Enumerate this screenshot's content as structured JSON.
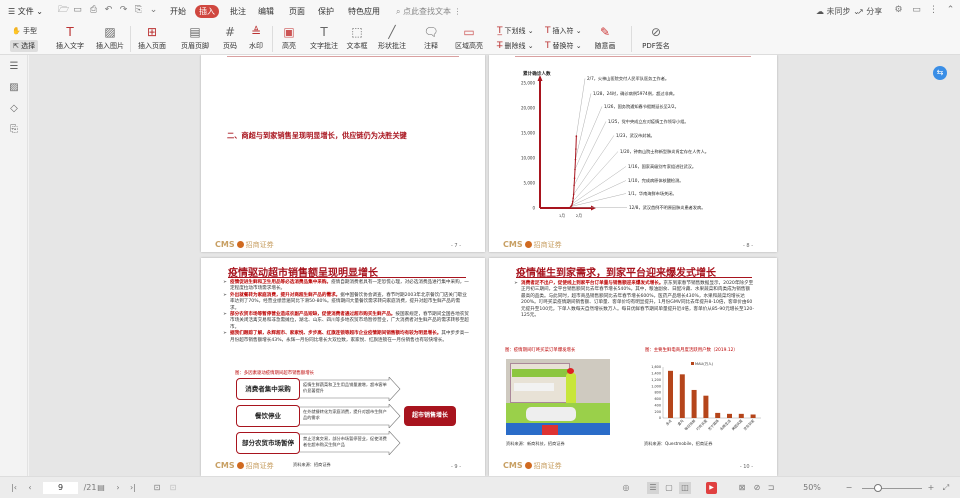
{
  "menu": {
    "file": "文件",
    "tabs": [
      "开始",
      "插入",
      "批注",
      "编辑",
      "页面",
      "保护",
      "特色应用"
    ],
    "active_tab": "插入",
    "search_placeholder": "点此查找文本",
    "sync": "未同步",
    "share": "分享"
  },
  "toolbar": {
    "hand": "手型",
    "select": "选择",
    "items": [
      "插入文字",
      "插入图片",
      "插入页面",
      "页眉页脚",
      "页码",
      "水印",
      "高亮",
      "文字批注",
      "文本框",
      "形状批注",
      "注释",
      "区域高亮"
    ],
    "underline": "下划线",
    "strikethrough": "删除线",
    "insert_mark": "插入符",
    "replace_mark": "替换符",
    "freehand": "随意画",
    "pdf_sign": "PDF签名"
  },
  "accent": "#d0473f",
  "brand": {
    "logo_text": "CMS",
    "logo_cn": "招商证券",
    "color": "#c8a064"
  },
  "pages": {
    "p7": {
      "heading": "二、商超与到家销售呈现明显增长，供应链仍为决胜关键",
      "page_no": "- 7 -"
    },
    "p8": {
      "page_no": "- 8 -"
    },
    "p9": {
      "title": "疫情驱动超市销售额呈现明显增长",
      "bullets": [
        {
          "bold": "疫情促进生鲜和卫生用品等必选消费品集中采购。",
          "text": "疫情自期消费者具有一定恐慌心理，对必选消费品进行集中采购，一定程度拉动市场需求增长。"
        },
        {
          "bold": "外出就餐转为家庭消费，提升对商超生鲜产品的需求。",
          "text": "据中国餐饮协会调查，春节时期2003年北京餐饮门店关门歇业率达到了70%，经营业绩普遍同比下滑50-80%。疫情期间大量餐饮需求转向家庭消费，提升对超市生鲜产品的需求。"
        },
        {
          "bold": "部分农贸市场等暂停营业造成农副产品短缺，促使消费者通过超市购买生鲜产品。",
          "text": "按国家规定，春节期间全国各地农贸市场关闭活禽交易和非急需摊位，湖北、山东、四川等多地农贸市场暂停营业，广大消费者对生鲜产品的需求转移至超市。"
        },
        {
          "bold": "据我们跟踪了解，永辉超市、家家悦、步步高、红旗连锁等超市企业疫情期间销售额均有较为明显增长。",
          "text": "其中步步高一月份超市销售额增长43%，永辉一月份同比增长大双位数，家家悦、红旗连锁在一月份销售也有较快增长。"
        }
      ],
      "figure_caption": "图：多因素驱动疫情期间超市销售额增长",
      "drivers": [
        {
          "label": "消费者集中采购",
          "desc": "疫情生鲜蔬菜和卫生用品销量激增，超市客单价显著提升"
        },
        {
          "label": "餐饮停业",
          "desc": "在外就餐转化为家庭消费，提升对超市生鲜产品的需求"
        },
        {
          "label": "部分农贸市场暂停",
          "desc": "禁止活禽交易，部分市场暂停营业，促使消费者在超市购买生鲜产品"
        }
      ],
      "result": "超市销售增长",
      "source": "资料来源：招商证券",
      "page_no": "- 9 -"
    },
    "p10": {
      "title": "疫情催生到家需求，到家平台迎来爆发式增长",
      "bullet": {
        "bold": "消费者足不出户，促使线上到家平台订单量与销售额迎来爆发式增长。",
        "text": "京东到家春节销售数据显示，2020年除夕至正月初三期间，全平台销售额同比去年春节增长540%。其中，粮油副食、日配冷藏、水果蔬菜和肉类成为销售额最高的品类。与此同时，超市商品销售额同比去年春节增长600%，医药产品增长430%，水果和蔬菜均增长达200%。叮咚买菜疫情期间销售额、订单量、客单价均有明显提升，1月份GMV同比去年提升8-10倍，客单价由60元提升至100元，下单人数每天自然增长数万人。每日优鲜春节期间单量提升近4倍，客单价从85-90元增长至120-125元。"
      },
      "photo_caption": "图：疫情期间叮咚买菜订单爆发增长",
      "photo_source": "资料来源：新商科技，招商证券",
      "chart_caption": "图：主要生鲜电商月度活跃用户数（2019.12）",
      "chart_source": "资料来源：Questmobile，招商证券",
      "page_no": "- 10 -"
    }
  },
  "chart_data": [
    {
      "type": "line",
      "ylabel": "累计确诊人数",
      "yticks": [
        "0",
        "5,000",
        "10,000",
        "15,000",
        "20,000",
        "25,000"
      ],
      "ylim": [
        0,
        25000
      ],
      "xticks": [
        "1月",
        "2月"
      ],
      "series": [
        {
          "name": "累计确诊",
          "x_day": [
            0,
            31,
            49,
            50,
            51,
            52,
            53,
            54,
            55,
            56,
            57,
            58,
            59,
            60,
            61,
            62,
            63
          ],
          "values": [
            0,
            41,
            62,
            198,
            291,
            440,
            571,
            830,
            1287,
            1975,
            2744,
            4515,
            5974,
            7711,
            9692,
            11791,
            14380
          ]
        }
      ],
      "annotations": [
        "2/7，火神山医院交付人民军队医务工作者。",
        "1/28，24时，确诊病例5974例，超过非典。",
        "1/26，国务院通知春节假期延长至2/2。",
        "1/25，党中央成立应对疫情工作领导小组。",
        "1/23，武汉市封城。",
        "1/20，钟南山院士称新型肺炎肯定存在人传人。",
        "1/16，国家高级别专家组进驻武汉。",
        "1/10，完成病原体核酸检测。",
        "1/1，华南海鲜市场关闭。",
        "12/8，武汉首例不明原因肺炎患者发病。"
      ]
    },
    {
      "type": "bar",
      "title": "主要生鲜电商月度活跃用户数（2019.12）",
      "legend": "MAU(万人)",
      "legend_position": "top",
      "categories": [
        "多点",
        "盒马",
        "每日优鲜",
        "叮咚买菜",
        "苏宁菜场",
        "永辉生活",
        "美团买菜",
        "京东到家"
      ],
      "values": [
        1480,
        1370,
        880,
        700,
        160,
        130,
        130,
        110
      ],
      "yticks": [
        "0",
        "200",
        "400",
        "600",
        "800",
        "1,000",
        "1,200",
        "1,400",
        "1,600"
      ],
      "ylim": [
        0,
        1600
      ],
      "color": "#b5451b"
    }
  ],
  "status": {
    "page_current": "9",
    "page_total": "/21",
    "zoom": "50%"
  }
}
